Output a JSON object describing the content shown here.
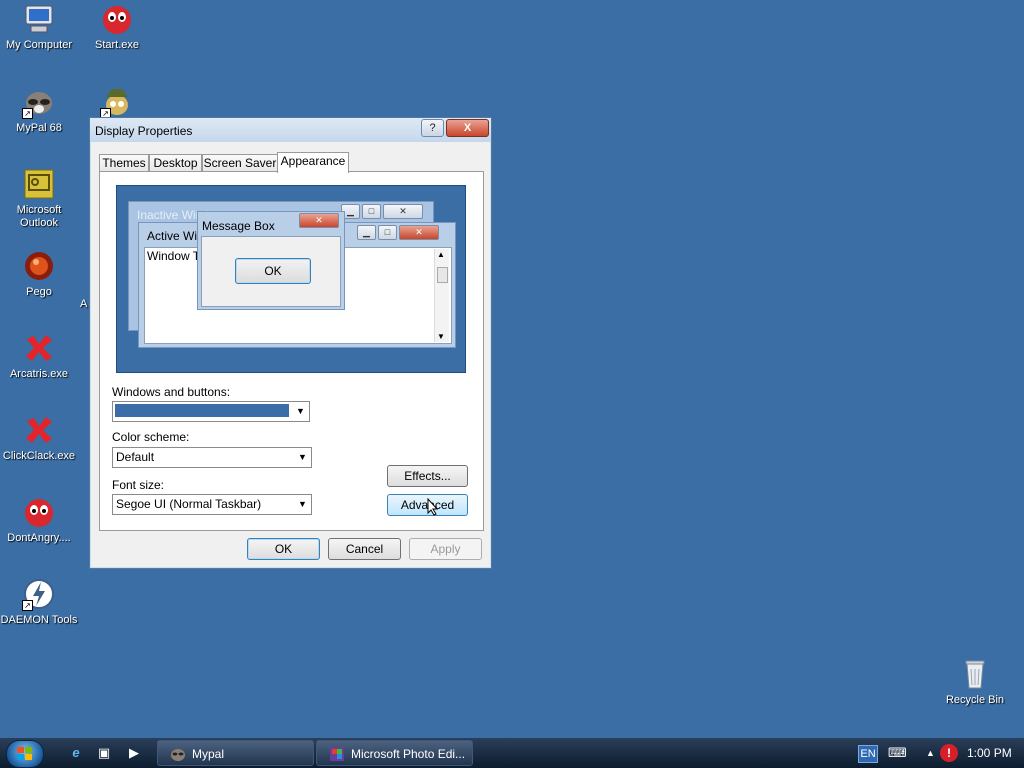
{
  "desktop": {
    "icons": [
      {
        "label": "My Computer",
        "icon": "my-computer-icon"
      },
      {
        "label": "Start.exe",
        "icon": "red-bird-icon"
      },
      {
        "label": "MyPal 68",
        "icon": "raccoon-icon"
      },
      {
        "label": "Microsoft Outlook",
        "icon": "outlook-icon"
      },
      {
        "label": "Pego",
        "icon": "pego-ball-icon"
      },
      {
        "label": "Arcatris.exe",
        "icon": "red-x-icon"
      },
      {
        "label": "ClickClack.exe",
        "icon": "red-x-icon"
      },
      {
        "label": "DontAngry....",
        "icon": "red-bird-icon"
      },
      {
        "label": "DAEMON Tools",
        "icon": "daemon-tools-icon"
      },
      {
        "label": "Recycle Bin",
        "icon": "recycle-bin-icon"
      }
    ],
    "partial_label": "A"
  },
  "dialog": {
    "title": "Display Properties",
    "help_label": "?",
    "close_label": "X",
    "tabs": [
      "Themes",
      "Desktop",
      "Screen Saver",
      "Appearance"
    ],
    "active_tab": "Appearance",
    "preview": {
      "inactive_title": "Inactive Window",
      "active_title": "Active Window",
      "window_text": "Window Text",
      "message_title": "Message Box",
      "message_ok": "OK"
    },
    "windows_buttons_label": "Windows and buttons:",
    "windows_buttons_color": "#3b6ea6",
    "color_scheme_label": "Color scheme:",
    "color_scheme_value": "Default",
    "font_size_label": "Font size:",
    "font_size_value": "Segoe UI (Normal Taskbar)",
    "effects_label": "Effects...",
    "advanced_label": "Advanced",
    "ok_label": "OK",
    "cancel_label": "Cancel",
    "apply_label": "Apply"
  },
  "taskbar": {
    "tasks": [
      {
        "label": "Mypal",
        "icon": "raccoon-icon"
      },
      {
        "label": "Microsoft Photo Edi...",
        "icon": "photo-editor-icon"
      }
    ],
    "language": "EN",
    "clock": "1:00 PM"
  }
}
